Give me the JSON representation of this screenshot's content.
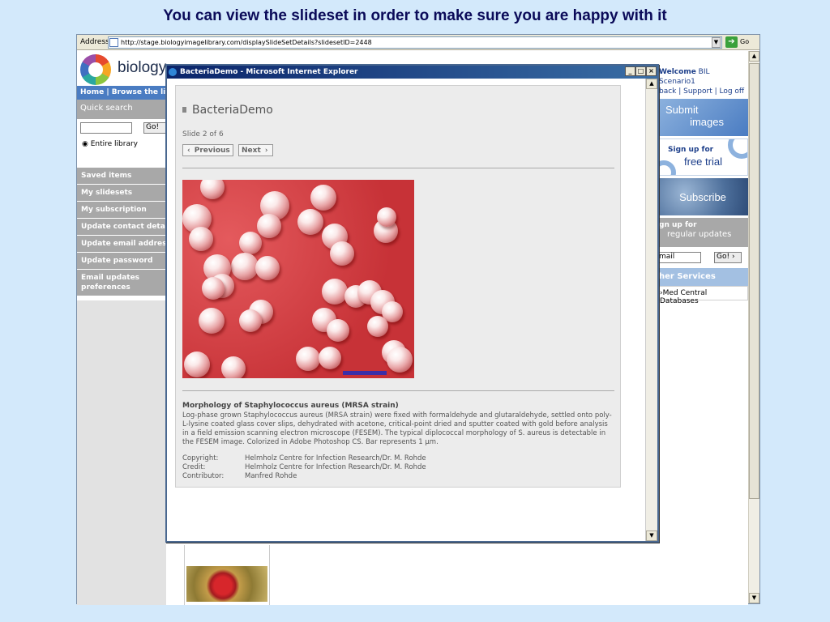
{
  "slide_title": "You can view the slideset in order to make sure you are happy with it",
  "browser": {
    "address_label": "Address",
    "url": "http://stage.biologyimagelibrary.com/displaySlideSetDetails?slidesetID=2448",
    "go_label": "Go"
  },
  "site": {
    "logo_text": "biology",
    "top_nav": "Home | Browse the li",
    "quick_search": "Quick search",
    "search_go": "Go!",
    "search_scope": "Entire library",
    "nav_items": [
      "Saved items",
      "My slidesets",
      "My subscription",
      "Update contact detai",
      "Update email addres",
      "Update password"
    ],
    "nav_email_updates": "Email updates preferences",
    "welcome_prefix": "Welcome",
    "welcome_user": "BIL Scenario1",
    "welcome_links": "back | Support | Log off",
    "submit_line1": "Submit",
    "submit_line2": "images",
    "free_trial_line1": "Sign up for",
    "free_trial_line2": "free trial",
    "subscribe": "Subscribe",
    "signup_line1": "gn up for",
    "signup_line2": "regular updates",
    "email_placeholder": "mail",
    "email_go": "Go!",
    "other_services": "her Services",
    "pubmed_link": "›Med Central Databases"
  },
  "popup": {
    "window_title": "BacteriaDemo - Microsoft Internet Explorer",
    "heading": "BacteriaDemo",
    "slide_count": "Slide 2 of 6",
    "prev_label": "Previous",
    "next_label": "Next",
    "caption_title": "Morphology of Staphylococcus aureus (MRSA strain)",
    "caption_body": "Log-phase grown Staphylococcus aureus (MRSA strain) were fixed with formaldehyde and glutaraldehyde, settled onto poly-L-lysine coated glass cover slips, dehydrated with acetone, critical-point dried and sputter coated with gold before analysis in a field emission scanning electron microscope (FESEM). The typical diplococcal morphology of S. aureus is detectable in the FESEM image. Colorized in Adobe Photoshop CS. Bar represents 1 µm.",
    "credits": [
      {
        "key": "Copyright:",
        "value": "Helmholz Centre for Infection Research/Dr. M. Rohde"
      },
      {
        "key": "Credit:",
        "value": "Helmholz Centre for Infection Research/Dr. M. Rohde"
      },
      {
        "key": "Contributor:",
        "value": "Manfred Rohde"
      }
    ]
  },
  "icons": {
    "window_minimize": "_",
    "window_maximize": "□",
    "window_close": "×",
    "scroll_up": "▲",
    "scroll_down": "▼",
    "dropdown": "▼",
    "go_arrow": "➔",
    "prev_chevron": "‹",
    "next_chevron": "›"
  },
  "colors": {
    "titlebar": "#0a246a",
    "nav_blue": "#4a7cc2",
    "nav_gray": "#a8a8a8",
    "micrograph_bg": "#c73237"
  }
}
